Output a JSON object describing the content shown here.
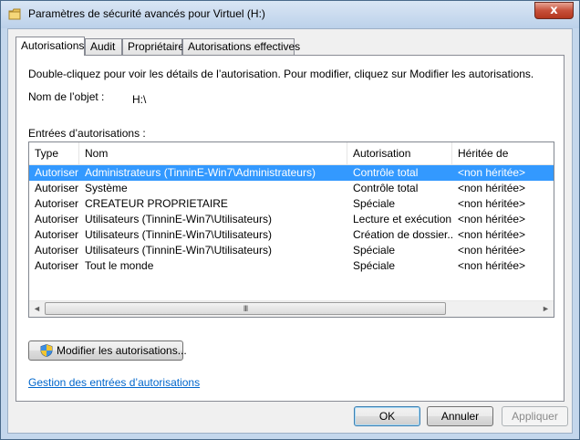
{
  "window": {
    "title": "Paramètres de sécurité avancés pour Virtuel (H:)",
    "close_symbol": "x",
    "icon": "folder-icon"
  },
  "tabs": [
    {
      "label": "Autorisations",
      "active": true
    },
    {
      "label": "Audit",
      "active": false
    },
    {
      "label": "Propriétaire",
      "active": false
    },
    {
      "label": "Autorisations effectives",
      "active": false
    }
  ],
  "panel": {
    "instructions": "Double-cliquez pour voir les détails de l’autorisation. Pour modifier, cliquez sur Modifier les autorisations.",
    "object_name_label": "Nom de l’objet :",
    "object_name_value": "H:\\",
    "entries_label": "Entrées d’autorisations :"
  },
  "table": {
    "columns": [
      "Type",
      "Nom",
      "Autorisation",
      "Héritée de"
    ],
    "rows": [
      {
        "type": "Autoriser",
        "name": "Administrateurs (TinninE-Win7\\Administrateurs)",
        "permission": "Contrôle total",
        "inherited": "<non héritée>",
        "selected": true
      },
      {
        "type": "Autoriser",
        "name": "Système",
        "permission": "Contrôle total",
        "inherited": "<non héritée>",
        "selected": false
      },
      {
        "type": "Autoriser",
        "name": "CREATEUR PROPRIETAIRE",
        "permission": "Spéciale",
        "inherited": "<non héritée>",
        "selected": false
      },
      {
        "type": "Autoriser",
        "name": "Utilisateurs (TinninE-Win7\\Utilisateurs)",
        "permission": "Lecture et exécution",
        "inherited": "<non héritée>",
        "selected": false
      },
      {
        "type": "Autoriser",
        "name": "Utilisateurs (TinninE-Win7\\Utilisateurs)",
        "permission": "Création de dossier...",
        "inherited": "<non héritée>",
        "selected": false
      },
      {
        "type": "Autoriser",
        "name": "Utilisateurs (TinninE-Win7\\Utilisateurs)",
        "permission": "Spéciale",
        "inherited": "<non héritée>",
        "selected": false
      },
      {
        "type": "Autoriser",
        "name": "Tout le monde",
        "permission": "Spéciale",
        "inherited": "<non héritée>",
        "selected": false
      }
    ],
    "scroll_left_symbol": "◄",
    "scroll_right_symbol": "►",
    "scroll_grip": "III"
  },
  "buttons": {
    "modify": "Modifier les autorisations...",
    "ok": "OK",
    "cancel": "Annuler",
    "apply": "Appliquer"
  },
  "link": {
    "manage": "Gestion des entrées d’autorisations"
  },
  "colors": {
    "selection": "#3399ff",
    "link": "#0066cc",
    "frame": "#c4d7ec"
  }
}
